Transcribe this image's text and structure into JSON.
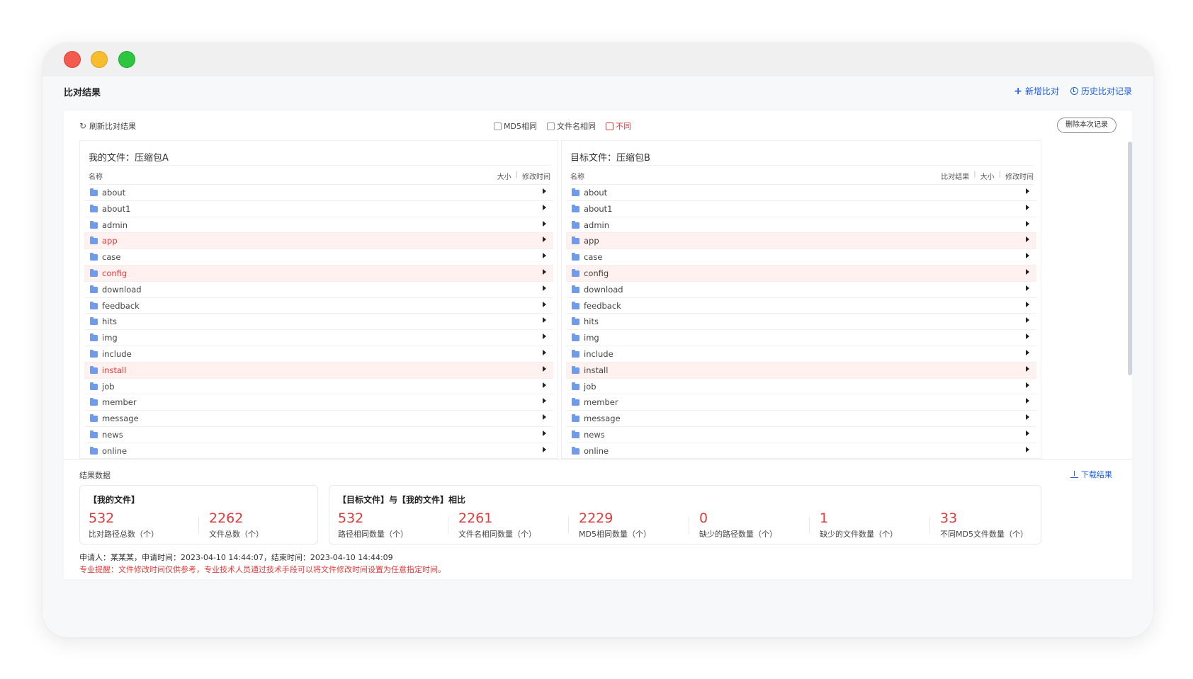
{
  "window": {
    "traffic_lights": [
      "close",
      "minimize",
      "maximize"
    ]
  },
  "header": {
    "title": "比对结果",
    "new_compare": "新增比对",
    "history": "历史比对记录"
  },
  "toolbar": {
    "refresh": "刷新比对结果",
    "filters": [
      {
        "label": "MD5相同",
        "checked": false
      },
      {
        "label": "文件名相同",
        "checked": false
      },
      {
        "label": "不同",
        "checked": false
      }
    ],
    "delete": "删除本次记录"
  },
  "left_panel": {
    "title": "我的文件：压缩包A",
    "col_name": "名称",
    "col_size": "大小",
    "col_mtime": "修改时间",
    "rows": [
      {
        "name": "about",
        "diff": false
      },
      {
        "name": "about1",
        "diff": false
      },
      {
        "name": "admin",
        "diff": false
      },
      {
        "name": "app",
        "diff": true
      },
      {
        "name": "case",
        "diff": false
      },
      {
        "name": "config",
        "diff": true
      },
      {
        "name": "download",
        "diff": false
      },
      {
        "name": "feedback",
        "diff": false
      },
      {
        "name": "hits",
        "diff": false
      },
      {
        "name": "img",
        "diff": false
      },
      {
        "name": "include",
        "diff": false
      },
      {
        "name": "install",
        "diff": true
      },
      {
        "name": "job",
        "diff": false
      },
      {
        "name": "member",
        "diff": false
      },
      {
        "name": "message",
        "diff": false
      },
      {
        "name": "news",
        "diff": false
      },
      {
        "name": "online",
        "diff": false
      }
    ]
  },
  "right_panel": {
    "title": "目标文件：压缩包B",
    "col_name": "名称",
    "col_result": "比对结果",
    "col_size": "大小",
    "col_mtime": "修改时间",
    "rows": [
      {
        "name": "about",
        "diff": false
      },
      {
        "name": "about1",
        "diff": false
      },
      {
        "name": "admin",
        "diff": false
      },
      {
        "name": "app",
        "diff": true
      },
      {
        "name": "case",
        "diff": false
      },
      {
        "name": "config",
        "diff": true
      },
      {
        "name": "download",
        "diff": false
      },
      {
        "name": "feedback",
        "diff": false
      },
      {
        "name": "hits",
        "diff": false
      },
      {
        "name": "img",
        "diff": false
      },
      {
        "name": "include",
        "diff": false
      },
      {
        "name": "install",
        "diff": true
      },
      {
        "name": "job",
        "diff": false
      },
      {
        "name": "member",
        "diff": false
      },
      {
        "name": "message",
        "diff": false
      },
      {
        "name": "news",
        "diff": false
      },
      {
        "name": "online",
        "diff": false
      }
    ]
  },
  "results": {
    "title": "结果数据",
    "download": "下载结果",
    "mine": {
      "title": "【我的文件】",
      "stats": [
        {
          "value": "532",
          "label": "比对路径总数（个）"
        },
        {
          "value": "2262",
          "label": "文件总数（个）"
        }
      ]
    },
    "compare": {
      "title": "【目标文件】与【我的文件】相比",
      "stats": [
        {
          "value": "532",
          "label": "路径相同数量（个）"
        },
        {
          "value": "2261",
          "label": "文件名相同数量（个）"
        },
        {
          "value": "2229",
          "label": "MD5相同数量（个）"
        },
        {
          "value": "0",
          "label": "缺少的路径数量（个）"
        },
        {
          "value": "1",
          "label": "缺少的文件数量（个）"
        },
        {
          "value": "33",
          "label": "不同MD5文件数量（个）"
        }
      ]
    },
    "meta": "申请人：某某某，申请时间：2023-04-10 14:44:07，结束时间：2023-04-10 14:44:09",
    "warning": "专业提醒：文件修改时间仅供参考，专业技术人员通过技术手段可以将文件修改时间设置为任意指定时间。"
  },
  "colors": {
    "accent": "#1f5fe0",
    "diff_red": "#e23a3a",
    "diff_row_bg": "#fff1f0",
    "folder": "#6f9bea"
  }
}
